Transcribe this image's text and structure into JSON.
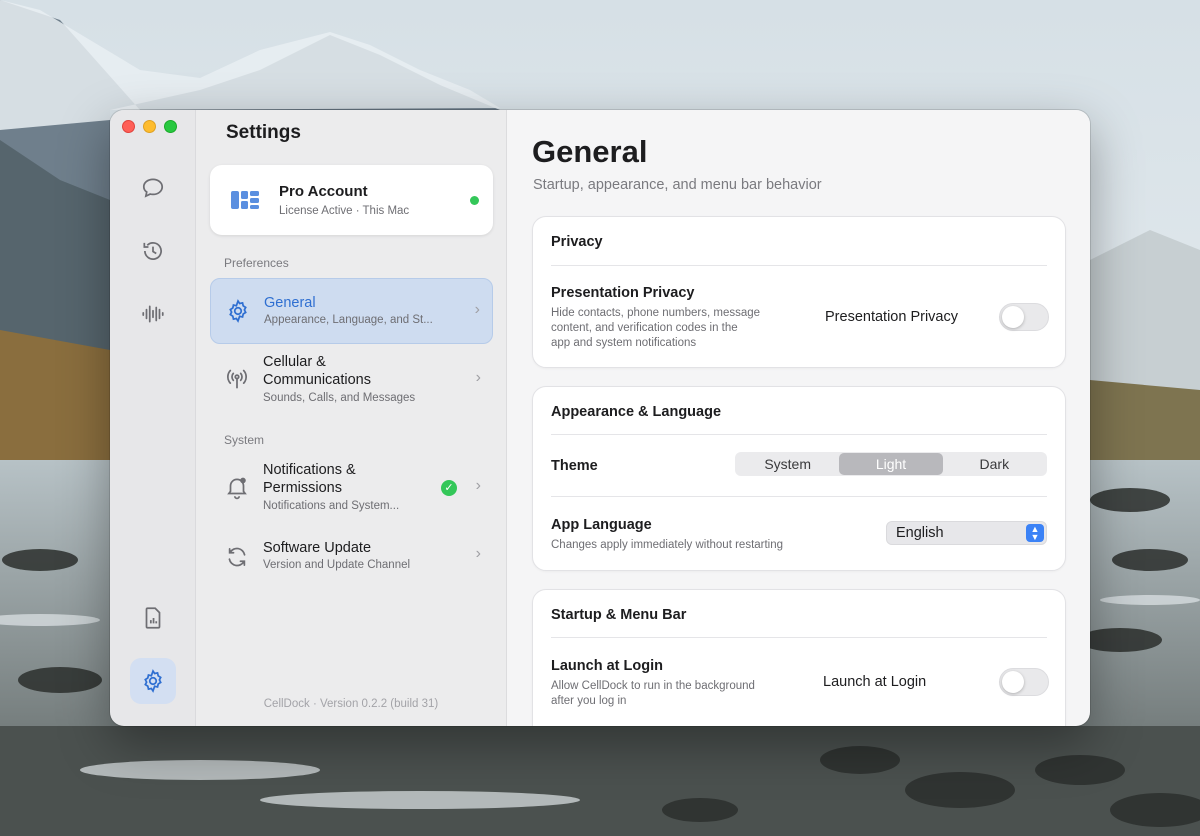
{
  "window": {
    "traffic_lights": [
      "close",
      "minimize",
      "zoom"
    ]
  },
  "rail": {
    "items": [
      {
        "icon": "chat-bubble-icon"
      },
      {
        "icon": "history-icon"
      },
      {
        "icon": "waveform-icon"
      },
      {
        "icon": "sim-card-icon"
      },
      {
        "icon": "gear-icon",
        "active": true
      }
    ]
  },
  "sidebar": {
    "title": "Settings",
    "pro": {
      "name": "Pro Account",
      "subtitle": "License Active · This Mac",
      "status_color": "#34c759"
    },
    "sections": [
      {
        "label": "Preferences",
        "items": [
          {
            "label": "General",
            "desc": "Appearance, Language, and St...",
            "icon": "gear-icon",
            "selected": true
          },
          {
            "label": "Cellular & Communications",
            "desc": "Sounds, Calls, and Messages",
            "icon": "antenna-icon"
          }
        ]
      },
      {
        "label": "System",
        "items": [
          {
            "label": "Notifications & Permissions",
            "desc": "Notifications and System...",
            "icon": "bell-icon",
            "badge": "check"
          },
          {
            "label": "Software Update",
            "desc": "Version and Update Channel",
            "icon": "refresh-icon"
          }
        ]
      }
    ],
    "footer": "CellDock · Version 0.2.2 (build 31)"
  },
  "main": {
    "title": "General",
    "subtitle": "Startup, appearance, and menu bar behavior",
    "privacy": {
      "title": "Privacy",
      "row_title": "Presentation Privacy",
      "row_desc_lines": [
        "Hide contacts, phone numbers, message",
        "content, and verification codes in the",
        "app and system notifications"
      ],
      "control_label": "Presentation Privacy",
      "enabled": false
    },
    "appearance": {
      "title": "Appearance & Language",
      "theme_label": "Theme",
      "theme_options": [
        "System",
        "Light",
        "Dark"
      ],
      "theme_selected": "Light",
      "language_label": "App Language",
      "language_desc": "Changes apply immediately without restarting",
      "language_value": "English"
    },
    "startup": {
      "title": "Startup & Menu Bar",
      "row_title": "Launch at Login",
      "row_desc_lines": [
        "Allow CellDock to run in the background",
        "after you log in"
      ],
      "control_label": "Launch at Login",
      "enabled": false
    }
  },
  "colors": {
    "accent": "#2f6fd1",
    "selected_bg": "#cedcf0",
    "success": "#34c759"
  }
}
